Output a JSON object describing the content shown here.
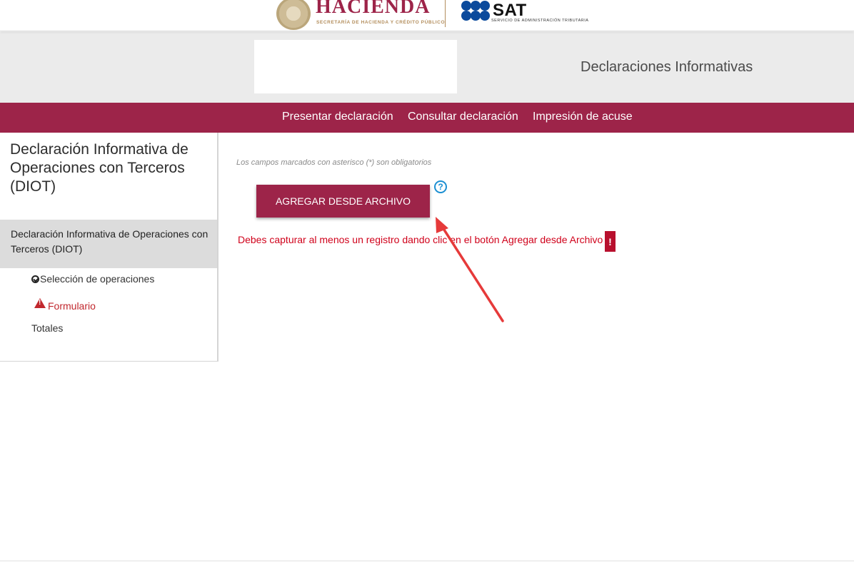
{
  "logo": {
    "hacienda_title": "HACIENDA",
    "hacienda_subtitle": "SECRETARÍA DE HACIENDA Y CRÉDITO PÚBLICO",
    "sat_title": "SAT",
    "sat_subtitle": "SERVICIO DE ADMINISTRACIÓN TRIBUTARIA"
  },
  "header": {
    "title": "Declaraciones Informativas"
  },
  "nav": {
    "items": [
      {
        "label": "Presentar declaración"
      },
      {
        "label": "Consultar declaración"
      },
      {
        "label": "Impresión de acuse"
      }
    ]
  },
  "sidebar": {
    "title": "Declaración Informativa de Operaciones con Terceros (DIOT)",
    "active_item": "Declaración Informativa de Operaciones con Terceros (DIOT)",
    "sub_items": [
      {
        "label": "Selección de operaciones",
        "status": "check-icon"
      },
      {
        "label": "Formulario",
        "status": "warning-icon"
      },
      {
        "label": "Totales"
      }
    ]
  },
  "main": {
    "required_note": "Los campos marcados con asterisco (*) son obligatorios",
    "add_button_label": "AGREGAR DESDE ARCHIVO",
    "help_symbol": "?",
    "error_message": "Debes capturar al menos un registro dando clic en el botón Agregar desde Archivo",
    "error_badge": "!"
  },
  "colors": {
    "brand": "#9d2449",
    "header_gray": "#ebebeb",
    "error_red": "#d0021b",
    "help_blue": "#1b8fd2",
    "arrow_red": "#e63a3a"
  }
}
